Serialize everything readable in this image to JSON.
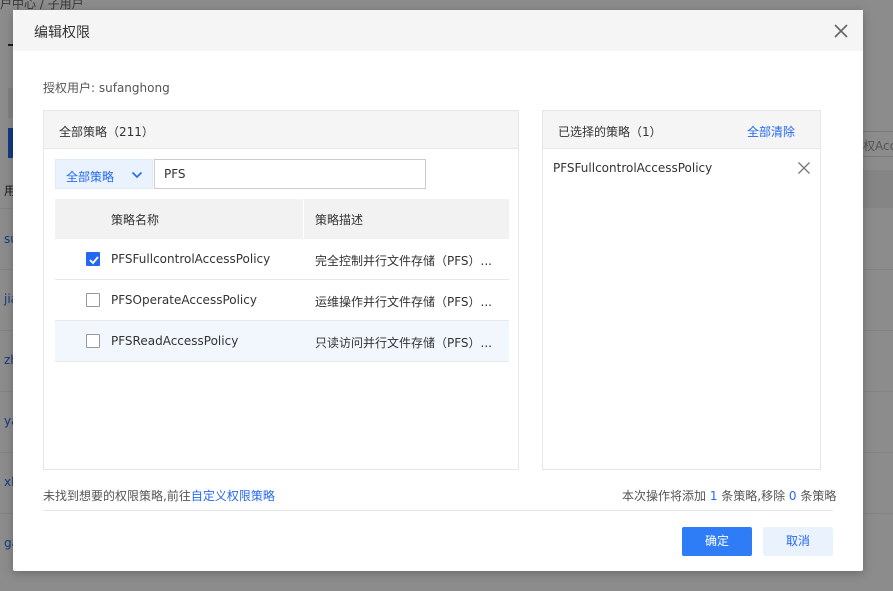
{
  "background": {
    "breadcrumb": "户中心 /  子用户",
    "table_head": "用",
    "row_prefixes": [
      "su",
      "jia",
      "zh",
      "ya",
      "xl",
      "ga"
    ],
    "right_input_fragment": "权Acce"
  },
  "dialog": {
    "title": "编辑权限",
    "close_icon": "close-icon",
    "authorized_user_label": "授权用户: ",
    "authorized_user": "sufanghong"
  },
  "all_policies": {
    "title": "全部策略（211）",
    "filter_label": "全部策略",
    "search_value": "PFS",
    "columns": [
      "策略名称",
      "策略描述"
    ],
    "rows": [
      {
        "name": "PFSFullcontrolAccessPolicy",
        "desc": "完全控制并行文件存储（PFS）...",
        "checked": true
      },
      {
        "name": "PFSOperateAccessPolicy",
        "desc": "运维操作并行文件存储（PFS）...",
        "checked": false
      },
      {
        "name": "PFSReadAccessPolicy",
        "desc": "只读访问并行文件存储（PFS）...",
        "checked": false
      }
    ]
  },
  "selected_policies": {
    "title": "已选择的策略（1）",
    "clear_all": "全部清除",
    "items": [
      "PFSFullcontrolAccessPolicy"
    ]
  },
  "footer": {
    "note_prefix": "未找到想要的权限策略,前往",
    "note_link": "自定义权限策略",
    "count_prefix": "本次操作将添加 ",
    "add_count": "1",
    "count_middle": " 条策略,移除 ",
    "remove_count": "0",
    "count_suffix": " 条策略",
    "ok": "确定",
    "cancel": "取消"
  },
  "colors": {
    "accent": "#2468f2",
    "primary_button": "#2e7cf6",
    "overlay": "rgba(0,0,0,0.45)"
  }
}
